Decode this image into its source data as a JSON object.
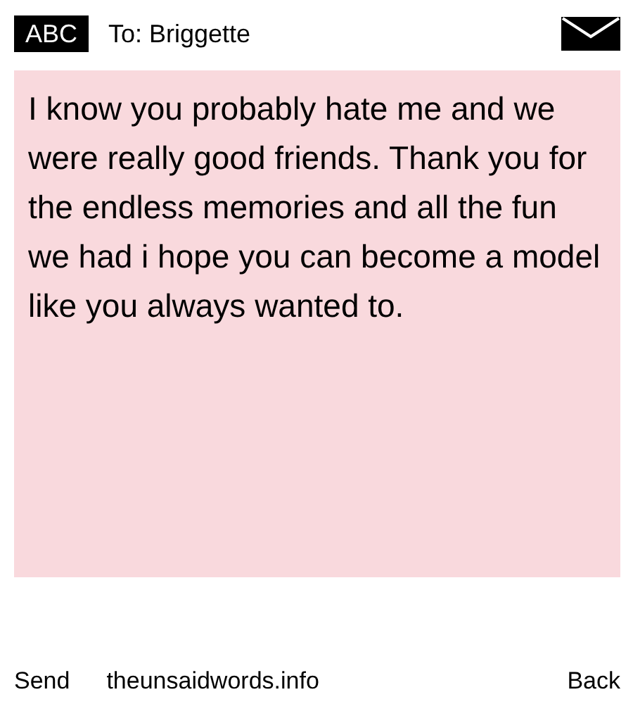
{
  "header": {
    "badge": "ABC",
    "recipient": "To: Briggette"
  },
  "message": {
    "text": "I know you probably hate me and we were really good friends. Thank you for the endless memories and all the fun we had i hope you can become a model like you always wanted to."
  },
  "footer": {
    "left": "Send",
    "center": "theunsaidwords.info",
    "right": "Back"
  }
}
